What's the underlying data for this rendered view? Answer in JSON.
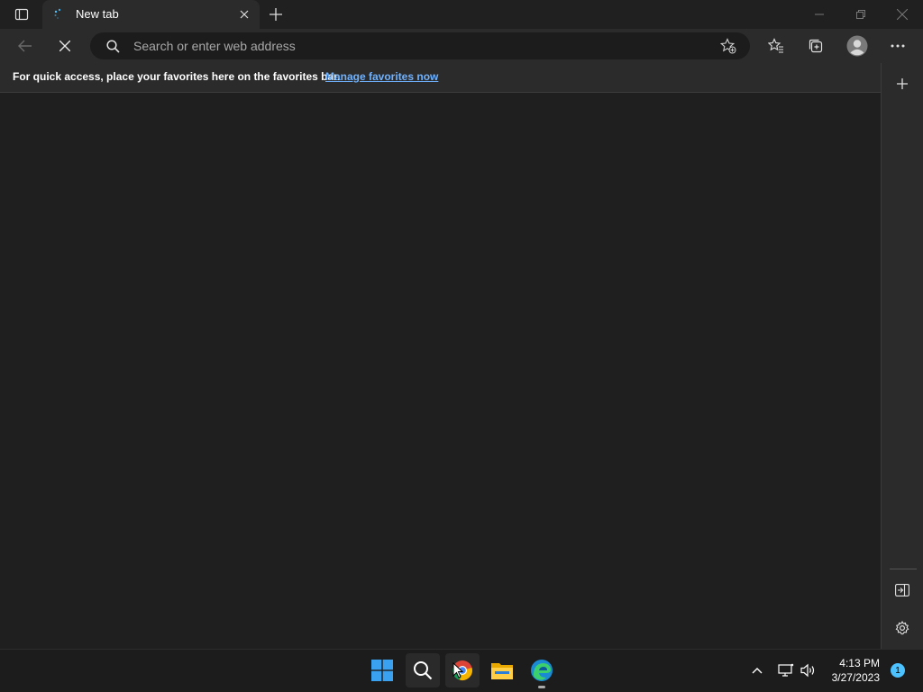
{
  "browser": {
    "tab": {
      "title": "New tab"
    },
    "address_bar": {
      "placeholder": "Search or enter web address"
    },
    "favorites_bar": {
      "message": "For quick access, place your favorites here on the favorites bar.",
      "link_label": "Manage favorites now"
    }
  },
  "taskbar": {
    "apps": [
      "start-icon",
      "search-icon",
      "chrome-icon",
      "file-explorer-icon",
      "edge-icon"
    ],
    "clock": {
      "time": "4:13 PM",
      "date": "3/27/2023"
    },
    "notification_count": "1"
  },
  "colors": {
    "accent_link": "#6fb2ff",
    "background": "#1f1f1f",
    "toolbar": "#2b2b2b",
    "badge": "#4cc2ff"
  }
}
